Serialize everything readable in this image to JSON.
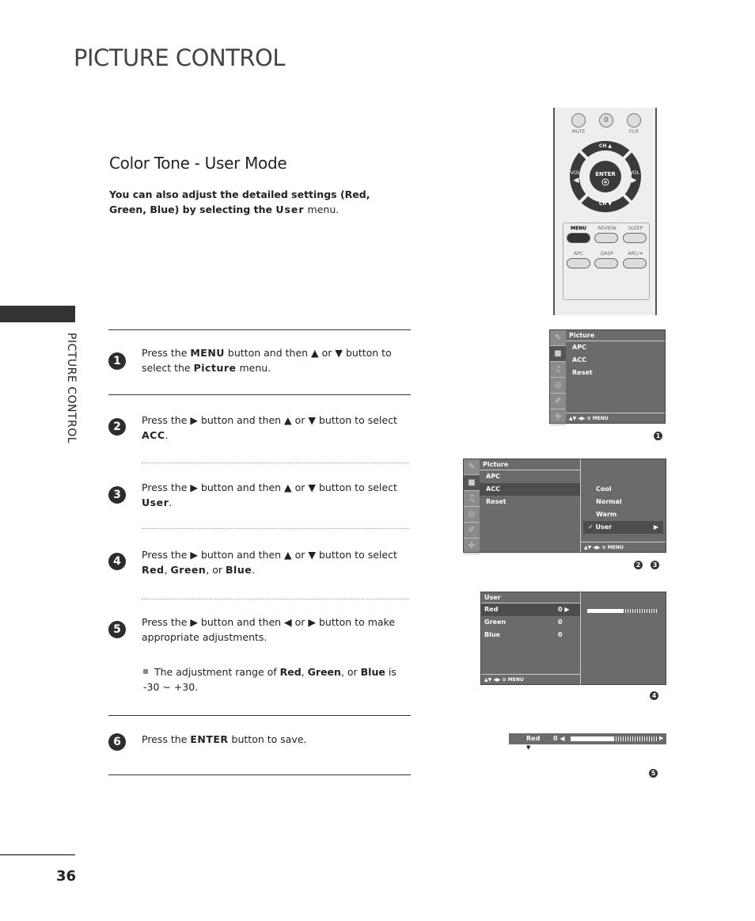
{
  "page": {
    "title": "PICTURE CONTROL",
    "side_label": "PICTURE CONTROL",
    "page_number": "36"
  },
  "section": {
    "title": "Color Tone - User Mode",
    "intro_pre": "You can also adjust the detailed settings (Red, Green, Blue) by selecting the ",
    "intro_key": "User",
    "intro_post": " menu."
  },
  "steps": [
    {
      "num": "1",
      "parts": [
        "Press the ",
        "MENU",
        " button and then ▲ or ▼ button to select the ",
        "Picture",
        " menu."
      ]
    },
    {
      "num": "2",
      "parts": [
        "Press the ▶ button and then ▲ or ▼ button to select ",
        "ACC",
        "."
      ]
    },
    {
      "num": "3",
      "parts": [
        "Press the ▶ button and then ▲ or ▼ button to select ",
        "User",
        "."
      ]
    },
    {
      "num": "4",
      "parts": [
        "Press the ▶ button and then ▲ or ▼ button to select ",
        "Red",
        ", ",
        "Green",
        ", or ",
        "Blue",
        "."
      ]
    },
    {
      "num": "5",
      "parts": [
        "Press the ▶ button and then ◀ or ▶ button to make appropriate adjustments."
      ]
    },
    {
      "num": "6",
      "parts": [
        "Press the ",
        "ENTER",
        " button to save."
      ]
    }
  ],
  "note": {
    "parts": [
      "The adjustment range of ",
      "Red",
      ", ",
      "Green",
      ", or ",
      "Blue",
      " is -30 ~ +30."
    ]
  },
  "remote": {
    "mute": "MUTE",
    "zero": "0",
    "fcr": "FCR",
    "ch_up": "CH ▲",
    "ch_down": "CH ▼",
    "vol_left": "VOL",
    "vol_right": "VOL",
    "enter": "ENTER",
    "menu": "MENU",
    "review": "REVIEW",
    "sleep": "SLEEP",
    "apc": "APC",
    "dasp": "DASP",
    "arc": "ARC/✶"
  },
  "osd1": {
    "title": "Picture",
    "items": [
      "APC",
      "ACC",
      "Reset"
    ],
    "footer": "▲▼  ◀▶  ⊙  MENU",
    "badge": "1"
  },
  "osd2": {
    "title": "Picture",
    "items": [
      "APC",
      "ACC",
      "Reset"
    ],
    "sub_items": [
      "Cool",
      "Normal",
      "Warm",
      "User"
    ],
    "selected_sub": "User",
    "footer": "▲▼  ◀▶  ⊙  MENU",
    "badges": [
      "2",
      "3"
    ]
  },
  "osd3": {
    "title": "User",
    "rows": [
      {
        "label": "Red",
        "value": "0 ▶"
      },
      {
        "label": "Green",
        "value": "0"
      },
      {
        "label": "Blue",
        "value": "0"
      }
    ],
    "slider_level": 0.5,
    "footer": "▲▼  ◀▶  ⊙  MENU",
    "badge": "4"
  },
  "osd4": {
    "label": "Red",
    "value": "0 ◀",
    "slider_level": 0.5,
    "badge": "5"
  }
}
